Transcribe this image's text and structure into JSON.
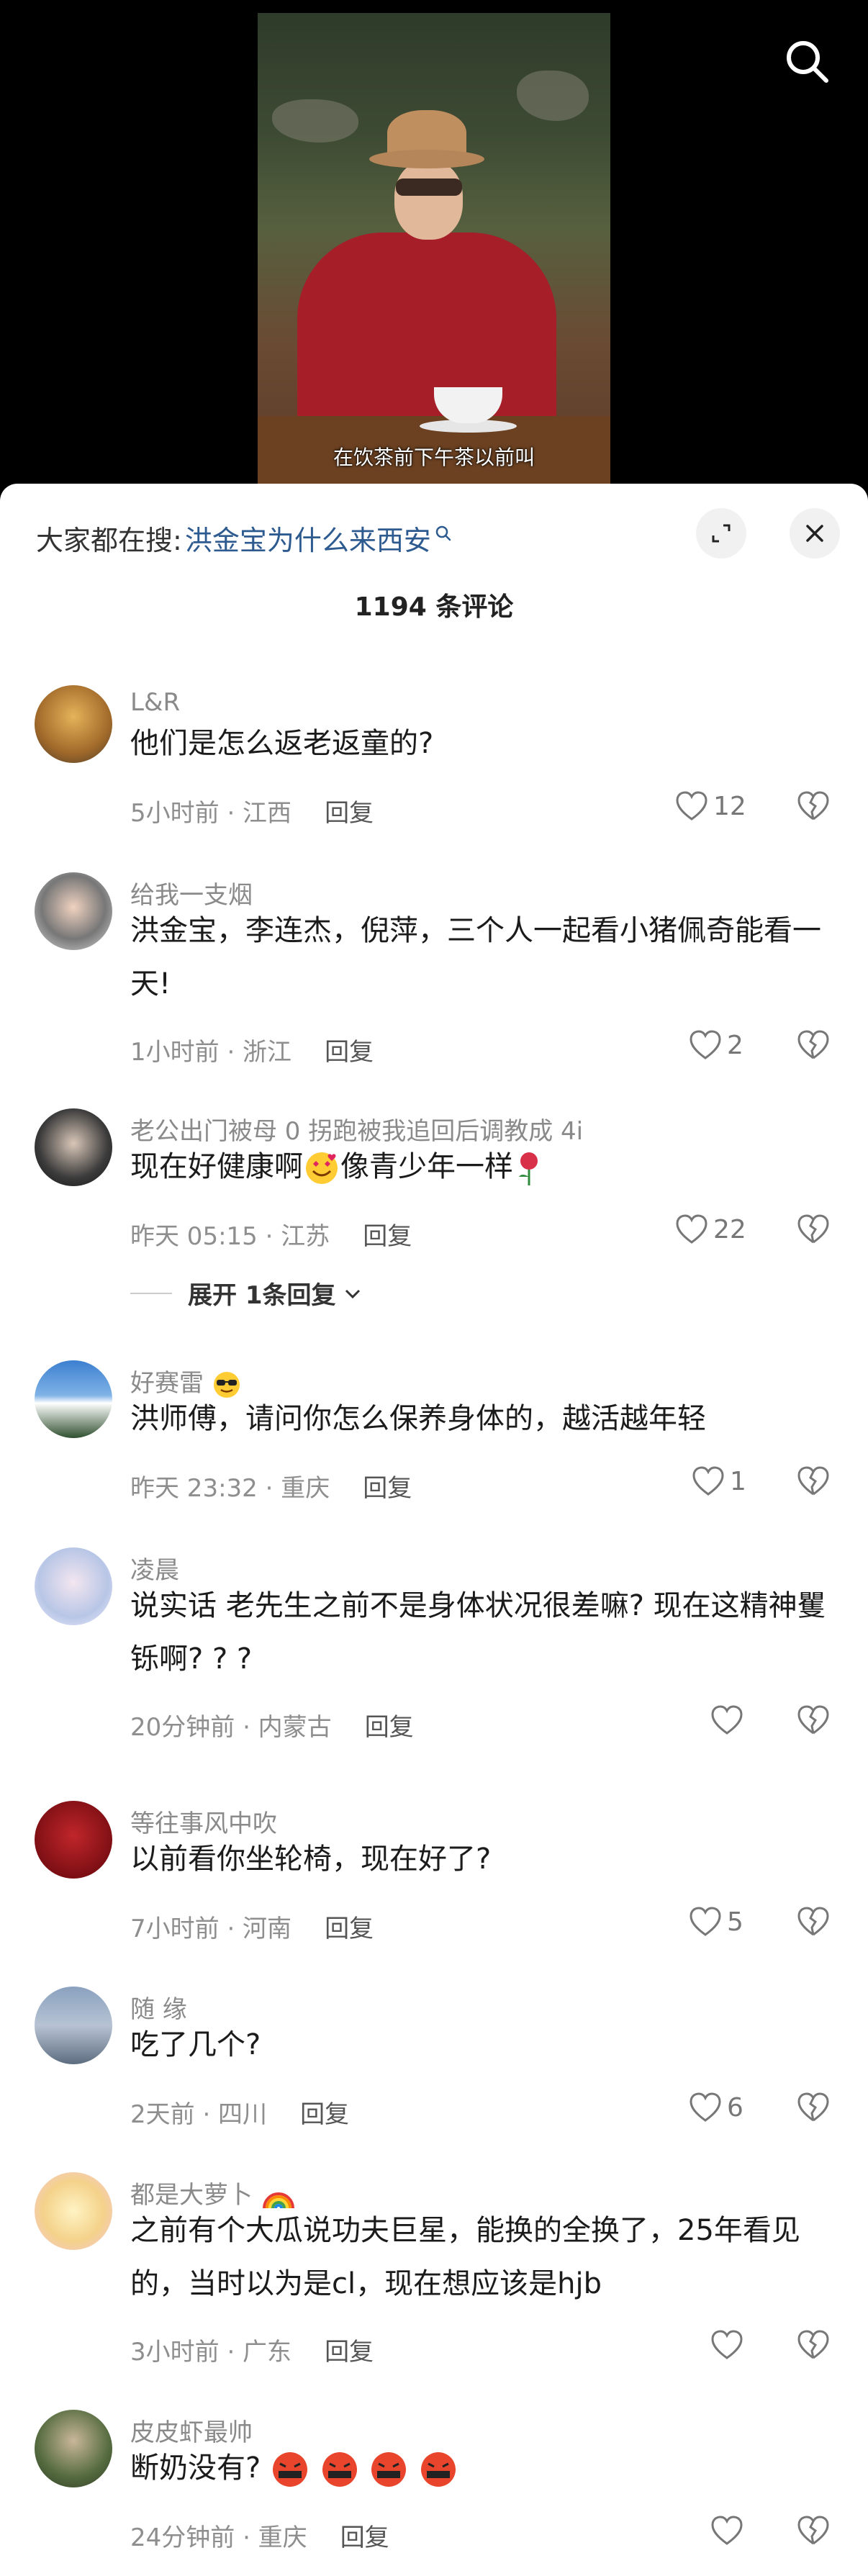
{
  "video": {
    "subtitle": "在饮茶前下午茶以前叫"
  },
  "sheet": {
    "hot_search_prefix": "大家都在搜:",
    "hot_search_term": "洪金宝为什么来西安",
    "comment_count": "1194 条评论"
  },
  "comments": [
    {
      "user": "L&R",
      "text": "他们是怎么返老返童的?",
      "time": "5小时前 · 江西",
      "reply": "回复",
      "likes": "12"
    },
    {
      "user": "给我一支烟",
      "text": "洪金宝，李连杰，倪萍，三个人一起看小猪佩奇能看一天!",
      "time": "1小时前 · 浙江",
      "reply": "回复",
      "likes": "2"
    },
    {
      "user": "老公出门被母 0 拐跑被我追回后调教成 4i",
      "text_a": "现在好健康啊",
      "text_b": "像青少年一样",
      "time": "昨天 05:15 · 江苏",
      "reply": "回复",
      "likes": "22",
      "expand": "展开 1条回复"
    },
    {
      "user": "好赛雷",
      "text": "洪师傅，请问你怎么保养身体的，越活越年轻",
      "time": "昨天 23:32 · 重庆",
      "reply": "回复",
      "likes": "1"
    },
    {
      "user": "凌晨",
      "text": "说实话  老先生之前不是身体状况很差嘛? 现在这精神矍铄啊? ? ?",
      "time": "20分钟前 · 内蒙古",
      "reply": "回复",
      "likes": ""
    },
    {
      "user": "等往事风中吹",
      "text": "以前看你坐轮椅，现在好了?",
      "time": "7小时前 · 河南",
      "reply": "回复",
      "likes": "5"
    },
    {
      "user": "随  缘",
      "text": "吃了几个?",
      "time": "2天前 · 四川",
      "reply": "回复",
      "likes": "6"
    },
    {
      "user": "都是大萝卜",
      "text": "之前有个大瓜说功夫巨星，能换的全换了，25年看见的，当时以为是cl，现在想应该是hjb",
      "time": "3小时前 · 广东",
      "reply": "回复",
      "likes": ""
    },
    {
      "user": "皮皮虾最帅",
      "text": "断奶没有?",
      "time": "24分钟前 · 重庆",
      "reply": "回复",
      "likes": ""
    }
  ],
  "colors": {
    "link": "#2d5a8f",
    "meta": "#8e8e8e",
    "video_bg": "#000000"
  },
  "icons": [
    "search-icon",
    "expand-icon",
    "close-icon",
    "heart-icon",
    "broken-heart-icon",
    "chevron-down-icon",
    "smiling-face-with-hearts-emoji",
    "rose-emoji",
    "sunglasses-emoji",
    "rainbow-emoji",
    "face-with-symbols-emoji"
  ]
}
